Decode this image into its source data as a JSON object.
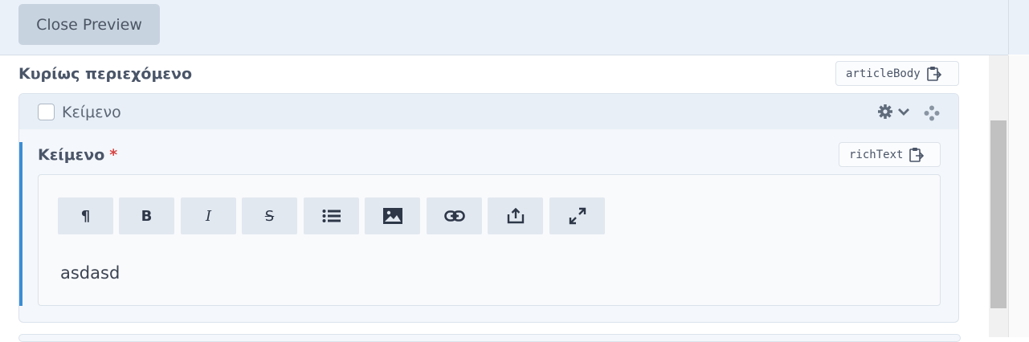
{
  "toolbar": {
    "close_preview": "Close Preview"
  },
  "section": {
    "title": "Κυρίως περιεχόμενο",
    "key_tag": "articleBody"
  },
  "block": {
    "checkbox_label": "Κείμενο",
    "checked": false
  },
  "field": {
    "label": "Κείμενο",
    "required_mark": "*",
    "key_tag": "richText"
  },
  "editor": {
    "tools": [
      {
        "icon": "paragraph-icon",
        "glyph": "¶"
      },
      {
        "icon": "bold-icon",
        "glyph": "B"
      },
      {
        "icon": "italic-icon",
        "glyph": "I"
      },
      {
        "icon": "strikethrough-icon",
        "glyph": "S"
      },
      {
        "icon": "bullet-list-icon",
        "glyph": ""
      },
      {
        "icon": "image-icon",
        "glyph": ""
      },
      {
        "icon": "link-icon",
        "glyph": ""
      },
      {
        "icon": "upload-icon",
        "glyph": ""
      },
      {
        "icon": "fullscreen-icon",
        "glyph": ""
      }
    ],
    "content": "asdasd"
  },
  "colors": {
    "accent_bar": "#3b8ed6",
    "required": "#d64545",
    "button_bg": "#c8d3e0"
  }
}
